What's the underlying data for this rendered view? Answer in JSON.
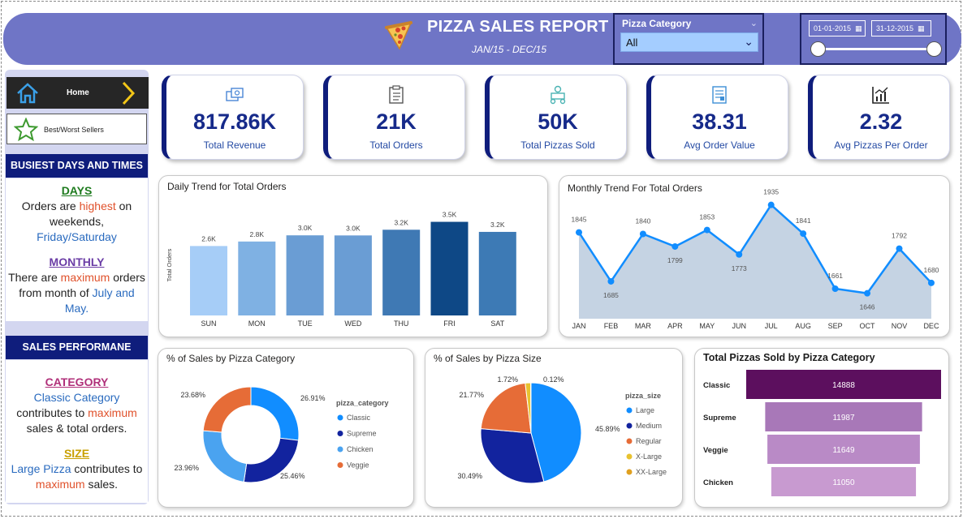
{
  "header": {
    "title": "PIZZA SALES REPORT",
    "subtitle": "JAN/15 - DEC/15",
    "category_slicer": {
      "label": "Pizza Category",
      "selected": "All"
    },
    "date_slicer": {
      "start": "01-01-2015",
      "end": "31-12-2015"
    }
  },
  "sidebar": {
    "nav": {
      "home_label": "Home",
      "best_worst_label": "Best/Worst Sellers"
    },
    "busiest": {
      "heading": "BUSIEST DAYS AND TIMES",
      "days_title": "DAYS",
      "days_p1": "Orders are ",
      "days_hl": "highest",
      "days_p2": " on weekends,",
      "days_blue": "Friday/Saturday",
      "monthly_title": "MONTHLY",
      "monthly_p1": "There are ",
      "monthly_hl": "maximum",
      "monthly_p2": " orders from month of ",
      "monthly_blue": "July and May."
    },
    "sales": {
      "heading": "SALES  PERFORMANE",
      "cat_title": "CATEGORY",
      "cat_blue": "Classic Category",
      "cat_p1": " contributes to ",
      "cat_hl": "maximum",
      "cat_p2": " sales & total orders.",
      "size_title": "SIZE",
      "size_blue": "Large Pizza",
      "size_p1": " contributes to ",
      "size_hl": "maximum",
      "size_p2": " sales."
    }
  },
  "kpis": [
    {
      "value": "817.86K",
      "label": "Total Revenue",
      "icon": "money-icon"
    },
    {
      "value": "21K",
      "label": "Total Orders",
      "icon": "clipboard-icon"
    },
    {
      "value": "50K",
      "label": "Total Pizzas Sold",
      "icon": "delivery-icon"
    },
    {
      "value": "38.31",
      "label": "Avg Order Value",
      "icon": "invoice-icon"
    },
    {
      "value": "2.32",
      "label": "Avg Pizzas Per Order",
      "icon": "chart-icon"
    }
  ],
  "colors": {
    "header_bg": "#6f75c6",
    "navy": "#0f1d7c",
    "kpi_value": "#162a8a"
  },
  "chart_data": [
    {
      "type": "bar",
      "title": "Daily Trend for Total Orders",
      "ylabel": "Total Orders",
      "categories": [
        "SUN",
        "MON",
        "TUE",
        "WED",
        "THU",
        "FRI",
        "SAT"
      ],
      "values": [
        2624,
        2794,
        3028,
        3024,
        3239,
        3538,
        3158
      ],
      "data_labels": [
        "2.6K",
        "2.8K",
        "3.0K",
        "3.0K",
        "3.2K",
        "3.5K",
        "3.2K"
      ],
      "colors": [
        "#a6cdf7",
        "#7fb1e3",
        "#6a9dd4",
        "#6a9dd4",
        "#3f79b4",
        "#0e4886",
        "#3d7ab5"
      ],
      "ylim": [
        0,
        3800
      ]
    },
    {
      "type": "area",
      "title": "Monthly Trend For Total Orders",
      "categories": [
        "JAN",
        "FEB",
        "MAR",
        "APR",
        "MAY",
        "JUN",
        "JUL",
        "AUG",
        "SEP",
        "OCT",
        "NOV",
        "DEC"
      ],
      "values": [
        1845,
        1685,
        1840,
        1799,
        1853,
        1773,
        1935,
        1841,
        1661,
        1646,
        1792,
        1680
      ],
      "ylim": [
        1600,
        1950
      ]
    },
    {
      "type": "pie",
      "title": "% of Sales by Pizza Category",
      "donut": true,
      "legend_title": "pizza_category",
      "labels": [
        "Classic",
        "Supreme",
        "Chicken",
        "Veggie"
      ],
      "values": [
        26.91,
        25.46,
        23.96,
        23.68
      ],
      "value_labels": [
        "26.91%",
        "25.46%",
        "23.96%",
        "23.68%"
      ],
      "colors": [
        "#118dff",
        "#12239e",
        "#4aa3f0",
        "#e66c37"
      ]
    },
    {
      "type": "pie",
      "title": "% of Sales by Pizza Size",
      "donut": false,
      "legend_title": "pizza_size",
      "labels": [
        "Large",
        "Medium",
        "Regular",
        "X-Large",
        "XX-Large"
      ],
      "values": [
        45.89,
        30.49,
        21.77,
        1.72,
        0.12
      ],
      "value_labels": [
        "45.89%",
        "30.49%",
        "21.77%",
        "1.72%",
        "0.12%"
      ],
      "colors": [
        "#118dff",
        "#12239e",
        "#e66c37",
        "#e8c230",
        "#e0a020"
      ]
    },
    {
      "type": "bar",
      "orientation": "horizontal-funnel",
      "title": "Total Pizzas Sold by Pizza Category",
      "categories": [
        "Classic",
        "Supreme",
        "Veggie",
        "Chicken"
      ],
      "values": [
        14888,
        11987,
        11649,
        11050
      ],
      "colors": [
        "#5c0f5e",
        "#a878b8",
        "#b98ac6",
        "#c89ad0"
      ]
    }
  ]
}
